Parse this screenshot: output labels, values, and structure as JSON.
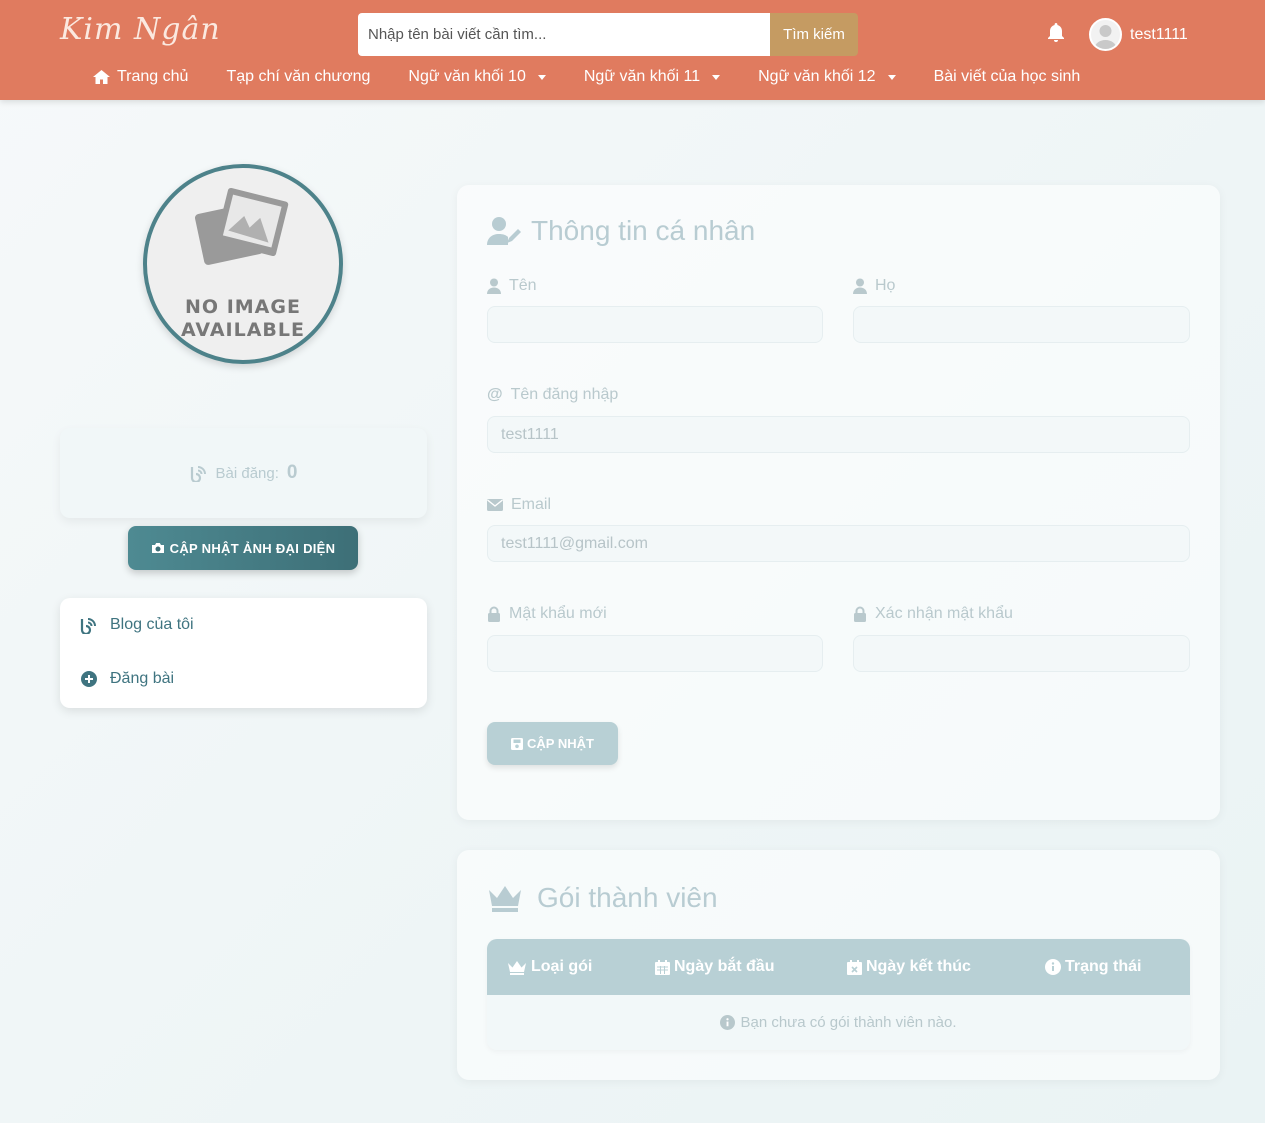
{
  "header": {
    "logo_text": "Kim Ngân",
    "search": {
      "placeholder": "Nhập tên bài viết cần tìm...",
      "value": ""
    },
    "search_button": "Tìm kiếm",
    "username": "test1111",
    "nav": [
      {
        "label": "Trang chủ",
        "icon": "home-icon",
        "dropdown": false
      },
      {
        "label": "Tạp chí văn chương",
        "dropdown": false
      },
      {
        "label": "Ngữ văn khối 10",
        "dropdown": true
      },
      {
        "label": "Ngữ văn khối 11",
        "dropdown": true
      },
      {
        "label": "Ngữ văn khối 12",
        "dropdown": true
      },
      {
        "label": "Bài viết của học sinh",
        "dropdown": false
      }
    ]
  },
  "sidebar": {
    "avatar_placeholder": "NO IMAGE AVAILABLE",
    "avatar_line1": "NO IMAGE",
    "avatar_line2": "AVAILABLE",
    "stats_label": "Bài đăng:",
    "stats_count": "0",
    "update_avatar_button": "CẬP NHẬT ẢNH ĐẠI DIỆN",
    "menu": [
      {
        "label": "Blog của tôi",
        "icon": "blog-icon"
      },
      {
        "label": "Đăng bài",
        "icon": "plus-circle-icon"
      }
    ]
  },
  "profile": {
    "title": "Thông tin cá nhân",
    "first_name_label": "Tên",
    "first_name_value": "",
    "last_name_label": "Họ",
    "last_name_value": "",
    "username_label": "Tên đăng nhập",
    "username_value": "test1111",
    "email_label": "Email",
    "email_value": "test1111@gmail.com",
    "new_password_label": "Mật khẩu mới",
    "confirm_password_label": "Xác nhận mật khẩu",
    "submit_button": "CẬP NHẬT"
  },
  "membership": {
    "title": "Gói thành viên",
    "columns": [
      "Loại gói",
      "Ngày bắt đầu",
      "Ngày kết thúc",
      "Trạng thái"
    ],
    "empty_message": "Bạn chưa có gói thành viên nào."
  },
  "colors": {
    "header_bg": "#e07b5f",
    "search_button_bg": "#c59b62",
    "accent_teal": "#4d828a",
    "muted_teal": "#b8d0d5"
  }
}
